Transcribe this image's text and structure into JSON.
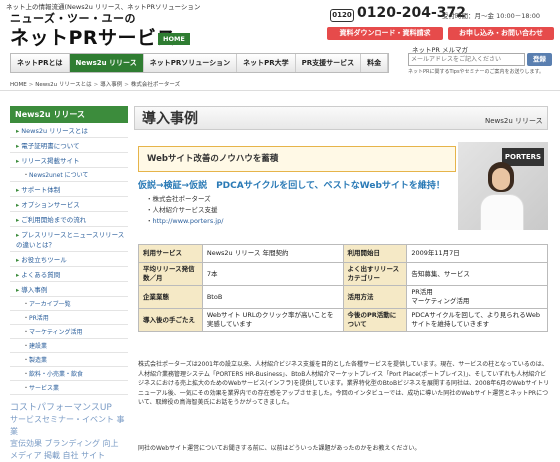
{
  "header": {
    "tagline": "ネット上の情報流通(News2u リリース、ネットPRソリューション",
    "brand_small": "ニューズ・ツー・ユーの",
    "brand_big": "ネットPRサービス",
    "home_badge": "HOME",
    "tel_icon": "0120",
    "tel": "0120-204-372",
    "hours": "受付時間：月～金 10:00－18:00",
    "doc_button": "資料ダウンロード・資料請求",
    "apply_button": "お申し込み・お問い合わせ"
  },
  "nav": {
    "items": [
      "ネットPRとは",
      "News2u リリース",
      "ネットPRソリューション",
      "ネットPR大学",
      "PR支援サービス",
      "料金"
    ],
    "active_index": 1
  },
  "magazine": {
    "label": "ネットPR メルマガ",
    "placeholder": "メールアドレスをご記入ください",
    "button": "登録",
    "note": "ネットPRに関するTipsやセミナーのご案内をお送りします。"
  },
  "breadcrumb": {
    "items": [
      "HOME",
      "News2u リリースとは",
      "導入事例",
      "株式会社ポーターズ"
    ],
    "separator": ">"
  },
  "sidebar": {
    "title": "News2u リリース",
    "items": [
      {
        "label": "News2u リリースとは",
        "type": "main"
      },
      {
        "label": "電子証明書について",
        "type": "main"
      },
      {
        "label": "リリース掲載サイト",
        "type": "main"
      },
      {
        "label": "News2unet について",
        "type": "child"
      },
      {
        "label": "サポート体制",
        "type": "main"
      },
      {
        "label": "オプションサービス",
        "type": "main"
      },
      {
        "label": "ご利用開始までの流れ",
        "type": "main"
      },
      {
        "label": "プレスリリースとニュースリリースの違いとは？",
        "type": "main"
      },
      {
        "label": "お役立ちツール",
        "type": "main"
      },
      {
        "label": "よくある質問",
        "type": "main"
      },
      {
        "label": "導入事例",
        "type": "main"
      },
      {
        "label": "アーカイブ一覧",
        "type": "child"
      },
      {
        "label": "PR活用",
        "type": "child"
      },
      {
        "label": "マーケティング活用",
        "type": "child"
      },
      {
        "label": "建設業",
        "type": "child"
      },
      {
        "label": "製造業",
        "type": "child"
      },
      {
        "label": "飲料・小売業・飲食",
        "type": "child"
      },
      {
        "label": "サービス業",
        "type": "child"
      }
    ],
    "promo_line1": "コストパフォーマンスUP",
    "promo_line2": "サービスセミナー・イベント 事業",
    "promo_line3": "宣伝効果 ブランディング 向上",
    "promo_line4": "メディア 掲載 自社 サイト"
  },
  "content": {
    "title": "導入事例",
    "subtitle": "News2u リリース",
    "case_tag": "Webサイト改善のノウハウを蓄積",
    "headline": "仮説→検証→仮説　PDCAサイクルを回して、ベストなWebサイトを維持！",
    "company": "株式会社ポーターズ",
    "business": "人材紹介サービス支援",
    "url": "http://www.porters.jp/",
    "photo_sign": "PORTERS",
    "table": [
      {
        "h1": "利用サービス",
        "v1": "News2u リリース 年間契約",
        "h2": "利用開始日",
        "v2": "2009年11月7日"
      },
      {
        "h1": "平均リリース発信数／月",
        "v1": "7本",
        "h2": "よく出すリリースカテゴリー",
        "v2": "告知募集、サービス"
      },
      {
        "h1": "企業業態",
        "v1": "BtoB",
        "h2": "活用方法",
        "v2": "PR活用\nマーケティング活用"
      },
      {
        "h1": "導入後の手ごたえ",
        "v1": "Webサイト URLのクリック率が高いことを実感しています",
        "h2": "今後のPR活動について",
        "v2": "PDCAサイクルを回して、より見られるWebサイトを維持していきます"
      }
    ],
    "description": "株式会社ポーターズは2001年の設立以来、人材紹介ビジネス支援を目的とした各種サービスを提供しています。現在、サービスの柱となっているのは、人材紹介業務管理システム「PORTERS HR-Business」、BtoB人材紹介マーケットプレイス「Port Place(ポートプレイス)」、そしていずれも人材紹介ビジネスにおける売上拡大のためのWebサービス(インフラ)を提供しています。業界特化型のBtoBビジネスを展開する同社は、2008年6月のWebサイトリニューアル後、一気にその効果を業界内での存在感をアップさせました。今回のインタビューでは、成功に導いた同社のWebサイト運営とネットPRについて、取締役の鳥海智美氏にお話をうかがってきました。",
    "description2": "同社のWebサイト運営についてお聞きする前に、以前はどういった課題があったのかをお教えください。"
  }
}
